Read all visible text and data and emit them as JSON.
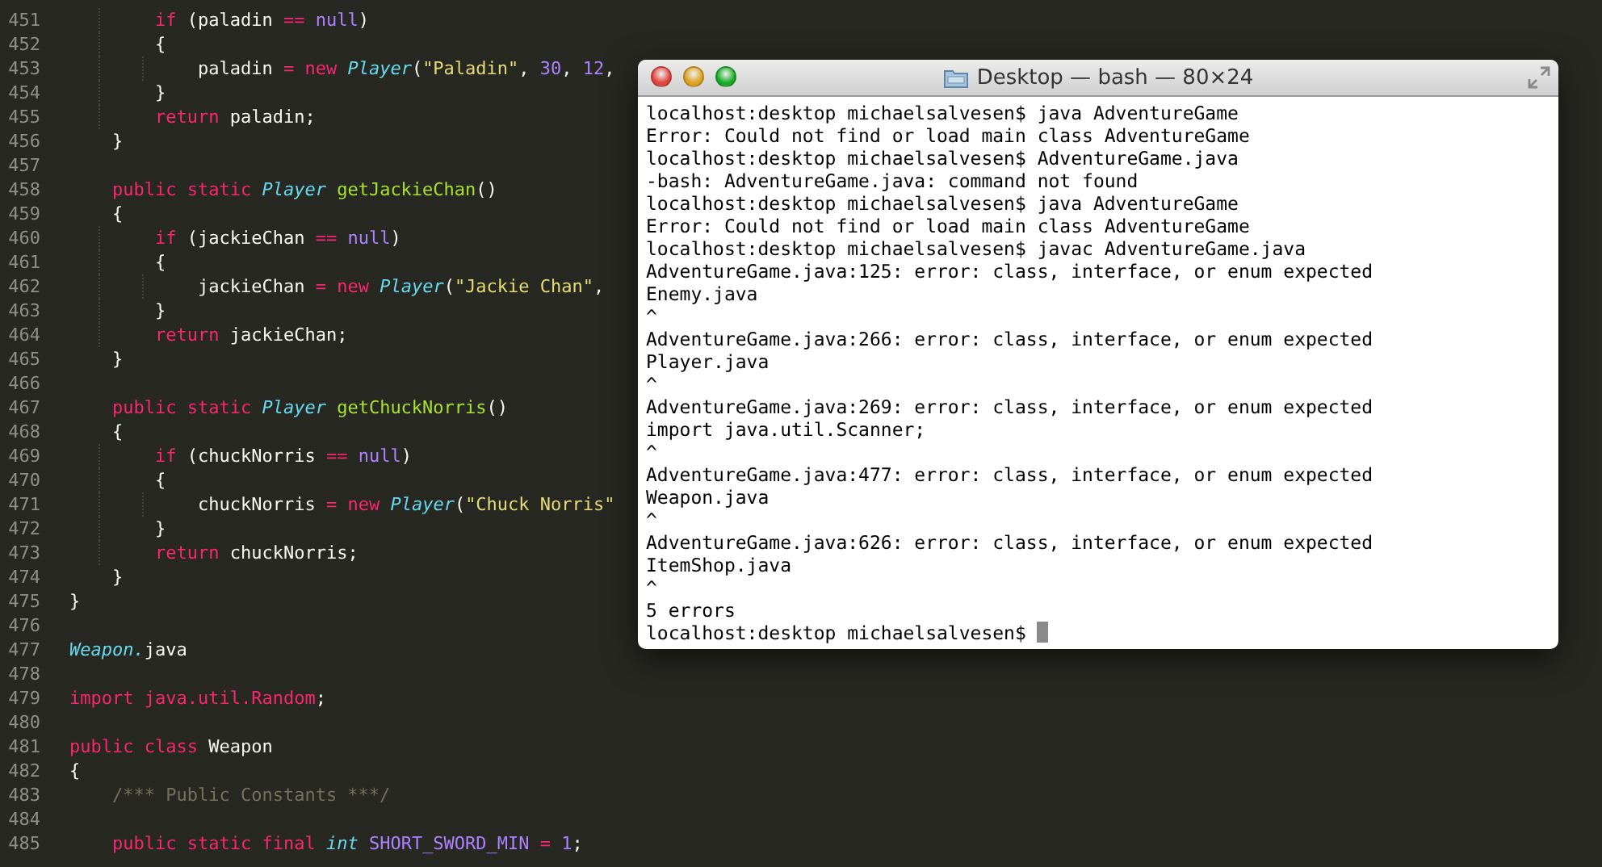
{
  "editor": {
    "lines": [
      {
        "number": "451",
        "tokens": [
          {
            "kind": "keyword",
            "text": "        if"
          },
          {
            "kind": "plain",
            "text": " (paladin "
          },
          {
            "kind": "keyword",
            "text": "=="
          },
          {
            "kind": "number",
            "text": " null"
          },
          {
            "kind": "plain",
            "text": ")"
          }
        ]
      },
      {
        "number": "452",
        "tokens": [
          {
            "kind": "plain",
            "text": "        {"
          }
        ]
      },
      {
        "number": "453",
        "tokens": [
          {
            "kind": "plain",
            "text": "            paladin "
          },
          {
            "kind": "keyword",
            "text": "="
          },
          {
            "kind": "keyword",
            "text": " new"
          },
          {
            "kind": "type",
            "text": " Player"
          },
          {
            "kind": "plain",
            "text": "("
          },
          {
            "kind": "string",
            "text": "\"Paladin\""
          },
          {
            "kind": "plain",
            "text": ","
          },
          {
            "kind": "number",
            "text": " 30"
          },
          {
            "kind": "plain",
            "text": ","
          },
          {
            "kind": "number",
            "text": " 12"
          },
          {
            "kind": "plain",
            "text": ","
          }
        ]
      },
      {
        "number": "454",
        "tokens": [
          {
            "kind": "plain",
            "text": "        }"
          }
        ]
      },
      {
        "number": "455",
        "tokens": [
          {
            "kind": "keyword",
            "text": "        return"
          },
          {
            "kind": "plain",
            "text": " paladin;"
          }
        ]
      },
      {
        "number": "456",
        "tokens": [
          {
            "kind": "plain",
            "text": "    }"
          }
        ]
      },
      {
        "number": "457"
      },
      {
        "number": "458",
        "tokens": [
          {
            "kind": "keyword",
            "text": "    public static"
          },
          {
            "kind": "type",
            "text": " Player"
          },
          {
            "kind": "func",
            "text": " getJackieChan"
          },
          {
            "kind": "plain",
            "text": "()"
          }
        ]
      },
      {
        "number": "459",
        "tokens": [
          {
            "kind": "plain",
            "text": "    {"
          }
        ]
      },
      {
        "number": "460",
        "tokens": [
          {
            "kind": "keyword",
            "text": "        if"
          },
          {
            "kind": "plain",
            "text": " (jackieChan "
          },
          {
            "kind": "keyword",
            "text": "=="
          },
          {
            "kind": "number",
            "text": " null"
          },
          {
            "kind": "plain",
            "text": ")"
          }
        ]
      },
      {
        "number": "461",
        "tokens": [
          {
            "kind": "plain",
            "text": "        {"
          }
        ]
      },
      {
        "number": "462",
        "tokens": [
          {
            "kind": "plain",
            "text": "            jackieChan "
          },
          {
            "kind": "keyword",
            "text": "="
          },
          {
            "kind": "keyword",
            "text": " new"
          },
          {
            "kind": "type",
            "text": " Player"
          },
          {
            "kind": "plain",
            "text": "("
          },
          {
            "kind": "string",
            "text": "\"Jackie Chan\""
          },
          {
            "kind": "plain",
            "text": ","
          }
        ]
      },
      {
        "number": "463",
        "tokens": [
          {
            "kind": "plain",
            "text": "        }"
          }
        ]
      },
      {
        "number": "464",
        "tokens": [
          {
            "kind": "keyword",
            "text": "        return"
          },
          {
            "kind": "plain",
            "text": " jackieChan;"
          }
        ]
      },
      {
        "number": "465",
        "tokens": [
          {
            "kind": "plain",
            "text": "    }"
          }
        ]
      },
      {
        "number": "466"
      },
      {
        "number": "467",
        "tokens": [
          {
            "kind": "keyword",
            "text": "    public static"
          },
          {
            "kind": "type",
            "text": " Player"
          },
          {
            "kind": "func",
            "text": " getChuckNorris"
          },
          {
            "kind": "plain",
            "text": "()"
          }
        ]
      },
      {
        "number": "468",
        "tokens": [
          {
            "kind": "plain",
            "text": "    {"
          }
        ]
      },
      {
        "number": "469",
        "tokens": [
          {
            "kind": "keyword",
            "text": "        if"
          },
          {
            "kind": "plain",
            "text": " (chuckNorris "
          },
          {
            "kind": "keyword",
            "text": "=="
          },
          {
            "kind": "number",
            "text": " null"
          },
          {
            "kind": "plain",
            "text": ")"
          }
        ]
      },
      {
        "number": "470",
        "tokens": [
          {
            "kind": "plain",
            "text": "        {"
          }
        ]
      },
      {
        "number": "471",
        "tokens": [
          {
            "kind": "plain",
            "text": "            chuckNorris "
          },
          {
            "kind": "keyword",
            "text": "="
          },
          {
            "kind": "keyword",
            "text": " new"
          },
          {
            "kind": "type",
            "text": " Player"
          },
          {
            "kind": "plain",
            "text": "("
          },
          {
            "kind": "string",
            "text": "\"Chuck Norris\""
          }
        ]
      },
      {
        "number": "472",
        "tokens": [
          {
            "kind": "plain",
            "text": "        }"
          }
        ]
      },
      {
        "number": "473",
        "tokens": [
          {
            "kind": "keyword",
            "text": "        return"
          },
          {
            "kind": "plain",
            "text": " chuckNorris;"
          }
        ]
      },
      {
        "number": "474",
        "tokens": [
          {
            "kind": "plain",
            "text": "    }"
          }
        ]
      },
      {
        "number": "475",
        "tokens": [
          {
            "kind": "plain",
            "text": "}"
          }
        ]
      },
      {
        "number": "476"
      },
      {
        "number": "477",
        "tokens": [
          {
            "kind": "type",
            "text": "Weapon."
          },
          {
            "kind": "plain",
            "text": "java"
          }
        ]
      },
      {
        "number": "478"
      },
      {
        "number": "479",
        "tokens": [
          {
            "kind": "keyword",
            "text": "import java.util.Random"
          },
          {
            "kind": "plain",
            "text": ";"
          }
        ]
      },
      {
        "number": "480"
      },
      {
        "number": "481",
        "tokens": [
          {
            "kind": "keyword",
            "text": "public class"
          },
          {
            "kind": "plain",
            "text": " Weapon"
          }
        ]
      },
      {
        "number": "482",
        "tokens": [
          {
            "kind": "plain",
            "text": "{"
          }
        ]
      },
      {
        "number": "483",
        "tokens": [
          {
            "kind": "comment",
            "text": "    /*** Public Constants ***/"
          }
        ]
      },
      {
        "number": "484"
      },
      {
        "number": "485",
        "tokens": [
          {
            "kind": "keyword",
            "text": "    public static final"
          },
          {
            "kind": "type",
            "text": " int"
          },
          {
            "kind": "number",
            "text": " SHORT_SWORD_MIN"
          },
          {
            "kind": "keyword",
            "text": " ="
          },
          {
            "kind": "number",
            "text": " 1"
          },
          {
            "kind": "plain",
            "text": ";"
          }
        ]
      }
    ]
  },
  "terminal": {
    "title": "Desktop — bash — 80×24",
    "lines": [
      "localhost:desktop michaelsalvesen$ java AdventureGame",
      "Error: Could not find or load main class AdventureGame",
      "localhost:desktop michaelsalvesen$ AdventureGame.java",
      "-bash: AdventureGame.java: command not found",
      "localhost:desktop michaelsalvesen$ java AdventureGame",
      "Error: Could not find or load main class AdventureGame",
      "localhost:desktop michaelsalvesen$ javac AdventureGame.java",
      "AdventureGame.java:125: error: class, interface, or enum expected",
      "Enemy.java",
      "^",
      "AdventureGame.java:266: error: class, interface, or enum expected",
      "Player.java",
      "^",
      "AdventureGame.java:269: error: class, interface, or enum expected",
      "import java.util.Scanner;",
      "^",
      "AdventureGame.java:477: error: class, interface, or enum expected",
      "Weapon.java",
      "^",
      "AdventureGame.java:626: error: class, interface, or enum expected",
      "ItemShop.java",
      "^",
      "5 errors"
    ],
    "prompt": "localhost:desktop michaelsalvesen$"
  }
}
